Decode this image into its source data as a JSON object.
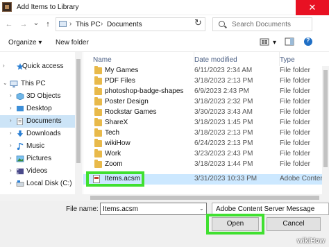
{
  "window": {
    "title": "Add Items to Library",
    "close_glyph": "✕"
  },
  "nav_buttons": {
    "back": "←",
    "forward": "→",
    "recent": "⌄",
    "up": "↑"
  },
  "address": {
    "crumbs": [
      "This PC",
      "Documents"
    ],
    "separator": "›",
    "dropdown": "⌄",
    "refresh": "↻"
  },
  "search": {
    "placeholder": "Search Documents"
  },
  "toolbar": {
    "organize_label": "Organize ▾",
    "new_folder_label": "New folder",
    "view_dd": "▾",
    "help": "?"
  },
  "nav_pane": {
    "items": [
      {
        "label": "Quick access",
        "icon": "star-icon",
        "caret": "›"
      },
      {
        "label": "This PC",
        "icon": "computer-icon",
        "caret": "⌄"
      },
      {
        "label": "3D Objects",
        "icon": "cube-icon",
        "caret": "›"
      },
      {
        "label": "Desktop",
        "icon": "desktop-icon",
        "caret": "›"
      },
      {
        "label": "Documents",
        "icon": "documents-icon",
        "caret": "›"
      },
      {
        "label": "Downloads",
        "icon": "download-icon",
        "caret": "›"
      },
      {
        "label": "Music",
        "icon": "music-icon",
        "caret": "›"
      },
      {
        "label": "Pictures",
        "icon": "pictures-icon",
        "caret": "›"
      },
      {
        "label": "Videos",
        "icon": "videos-icon",
        "caret": "›"
      },
      {
        "label": "Local Disk (C:)",
        "icon": "disk-icon",
        "caret": "›"
      }
    ],
    "selected": "Documents"
  },
  "file_list": {
    "columns": [
      "Name",
      "Date modified",
      "Type"
    ],
    "rows": [
      {
        "name": "My Games",
        "date": "6/11/2023 2:34 AM",
        "type": "File folder"
      },
      {
        "name": "PDF Files",
        "date": "3/18/2023 2:13 PM",
        "type": "File folder"
      },
      {
        "name": "photoshop-badge-shapes",
        "date": "6/9/2023 2:43 PM",
        "type": "File folder"
      },
      {
        "name": "Poster Design",
        "date": "3/18/2023 2:32 PM",
        "type": "File folder"
      },
      {
        "name": "Rockstar Games",
        "date": "3/30/2023 3:43 AM",
        "type": "File folder"
      },
      {
        "name": "ShareX",
        "date": "3/18/2023 1:45 PM",
        "type": "File folder"
      },
      {
        "name": "Tech",
        "date": "3/18/2023 2:13 PM",
        "type": "File folder"
      },
      {
        "name": "wikiHow",
        "date": "6/24/2023 2:13 PM",
        "type": "File folder"
      },
      {
        "name": "Work",
        "date": "3/23/2023 2:43 PM",
        "type": "File folder"
      },
      {
        "name": "Zoom",
        "date": "3/18/2023 1:44 PM",
        "type": "File folder"
      },
      {
        "name": "Items.acsm",
        "date": "3/31/2023 10:33 PM",
        "type": "Adobe Conten"
      }
    ],
    "selected_file": "Items.acsm"
  },
  "footer": {
    "file_name_label": "File name:",
    "file_name_value": "Items.acsm",
    "file_type_filter": "Adobe Content Server Message",
    "open_label": "Open",
    "cancel_label": "Cancel",
    "dd": "⌄"
  },
  "watermark": "wikiHow",
  "colors": {
    "highlight": "#40e030",
    "selection": "#cce8ff",
    "folder": "#e8b94a"
  }
}
